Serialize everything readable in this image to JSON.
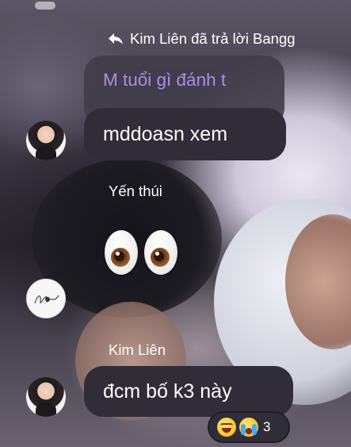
{
  "chat": {
    "reply_header": "Kim Liên đã trả lời Bangg",
    "quoted_message": "M tuổi gì đánh t",
    "messages": [
      {
        "text": "mddoasn xem"
      },
      {
        "sender": "Yến thúi",
        "emoji": "👀",
        "emoji_name": "eyes-emoji"
      },
      {
        "sender": "Kim Liên",
        "text": "đcm bố k3 này"
      }
    ],
    "reactions": {
      "emojis": [
        "laughing-face-icon",
        "crying-face-icon"
      ],
      "count": "3"
    }
  },
  "colors": {
    "bubble": "#302d38",
    "quoted_text": "#a98fe6",
    "text": "#ffffff"
  }
}
